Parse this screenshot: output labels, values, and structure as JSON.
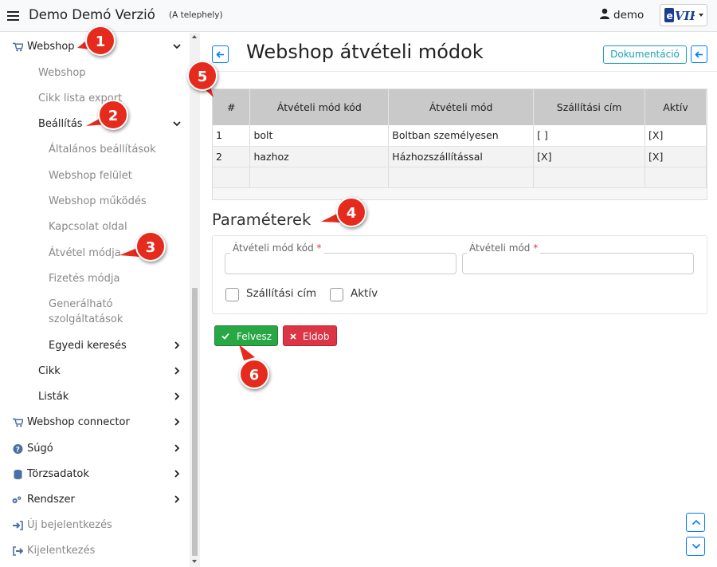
{
  "header": {
    "title": "Demo Demó Verzió",
    "subtitle": "(A telephely)",
    "user": "demo",
    "logo_text": "eVIR"
  },
  "sidebar": {
    "items": [
      {
        "label": "Webshop",
        "icon": "cart-icon",
        "expanded": true
      },
      {
        "label": "Webshop"
      },
      {
        "label": "Cikk lista export"
      },
      {
        "label": "Beállítás",
        "expanded": true
      },
      {
        "label": "Általános beállítások"
      },
      {
        "label": "Webshop felület"
      },
      {
        "label": "Webshop működés"
      },
      {
        "label": "Kapcsolat oldal"
      },
      {
        "label": "Átvétel módja"
      },
      {
        "label": "Fizetés módja"
      },
      {
        "label": "Generálható"
      },
      {
        "label": "szolgáltatások"
      },
      {
        "label": "Egyedi keresés"
      },
      {
        "label": "Cikk"
      },
      {
        "label": "Listák"
      },
      {
        "label": "Webshop connector",
        "icon": "cart-icon"
      },
      {
        "label": "Súgó",
        "icon": "question-circle-icon"
      },
      {
        "label": "Törzsadatok",
        "icon": "database-icon"
      },
      {
        "label": "Rendszer",
        "icon": "gears-icon"
      },
      {
        "label": "Új bejelentkezés",
        "icon": "sign-in-icon"
      },
      {
        "label": "Kijelentkezés",
        "icon": "sign-out-icon"
      }
    ]
  },
  "main": {
    "title": "Webshop átvételi módok",
    "doc_button": "Dokumentáció",
    "table": {
      "columns": [
        "#",
        "Átvételi mód kód",
        "Átvételi mód",
        "Szállítási cím",
        "Aktív"
      ],
      "rows": [
        [
          "1",
          "bolt",
          "Boltban személyesen",
          "[ ]",
          "[X]"
        ],
        [
          "2",
          "hazhoz",
          "Házhozszállítással",
          "[X]",
          "[X]"
        ]
      ]
    },
    "params": {
      "title": "Paraméterek",
      "code_label": "Átvételi mód kód",
      "code_value": "",
      "name_label": "Átvételi mód",
      "name_value": "",
      "required_mark": "*",
      "shipping_label": "Szállítási cím",
      "active_label": "Aktív"
    },
    "buttons": {
      "save": "Felvesz",
      "discard": "Eldob"
    }
  },
  "callouts": [
    "1",
    "2",
    "3",
    "4",
    "5",
    "6"
  ],
  "colors": {
    "primary": "#007bff",
    "info": "#17a2b8",
    "success": "#28a745",
    "danger": "#dc3545",
    "callout": "#e52b1d"
  }
}
